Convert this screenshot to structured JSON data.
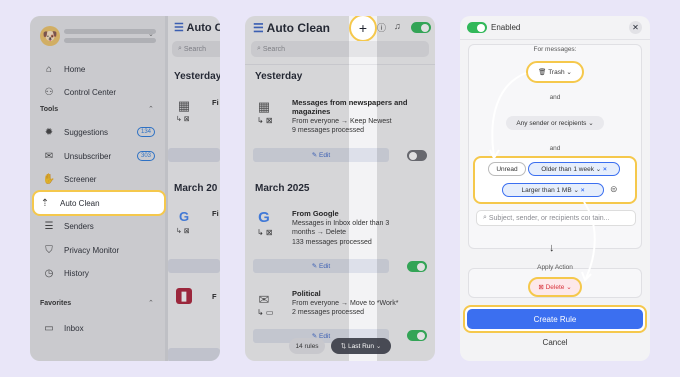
{
  "panel1": {
    "avatar": "🐶",
    "nav_items": [
      {
        "label": "Home",
        "icon": "home-icon"
      },
      {
        "label": "Control Center",
        "icon": "control-center-icon"
      }
    ],
    "tools_heading": "Tools",
    "tools": [
      {
        "label": "Suggestions",
        "icon": "lightbulb-icon",
        "badge": "134"
      },
      {
        "label": "Unsubscriber",
        "icon": "unsubscribe-icon",
        "badge": "303"
      },
      {
        "label": "Screener",
        "icon": "hand-icon",
        "badge": ""
      },
      {
        "label": "Auto Clean",
        "icon": "auto-clean-icon",
        "badge": ""
      },
      {
        "label": "Senders",
        "icon": "senders-icon",
        "badge": ""
      },
      {
        "label": "Privacy Monitor",
        "icon": "shield-icon",
        "badge": ""
      },
      {
        "label": "History",
        "icon": "history-icon",
        "badge": ""
      }
    ],
    "favorites_heading": "Favorites",
    "favorites": [
      {
        "label": "Inbox",
        "icon": "inbox-icon"
      }
    ],
    "main_title": "Auto Cl",
    "search": "Search",
    "day1": "Yesterday",
    "day2": "March 20",
    "item_snippets": [
      "Fi",
      "Fi",
      "Fi",
      "F"
    ]
  },
  "panel2": {
    "title": "Auto Clean",
    "search": "Search",
    "sections": [
      {
        "heading": "Yesterday"
      },
      {
        "heading": "March 2025"
      }
    ],
    "rules": [
      {
        "title": "Messages from newspapers and magazines",
        "line1": "From everyone → Keep Newest",
        "line2": "9 messages processed",
        "enabled": false
      },
      {
        "title": "From Google",
        "line1": "Messages in Inbox older than 3 months → Delete",
        "line2": "133 messages processed",
        "enabled": true
      },
      {
        "title": "Political",
        "line1": "From everyone → Move to *Work*",
        "line2": "2 messages processed",
        "enabled": true
      }
    ],
    "edit_label": "Edit",
    "rule_count": "14 rules",
    "sort_label": "Last Run",
    "colors": {
      "accent": "#32b85a",
      "link": "#3b66c8",
      "highlight": "#f5c84c"
    }
  },
  "panel3": {
    "enabled_label": "Enabled",
    "for_messages": "For messages:",
    "folder": "Trash",
    "and1": "and",
    "sender_select": "Any sender or recipients",
    "and2": "and",
    "unread": "Unread",
    "older": "Older than 1 week",
    "larger": "Larger than 1 MB",
    "search_placeholder": "Subject, sender, or recipients contain...",
    "apply_action": "Apply Action",
    "action": "Delete",
    "create_rule": "Create Rule",
    "cancel": "Cancel",
    "colors": {
      "primary": "#3b6ff0",
      "delete": "#d8323c",
      "highlight": "#f5c84c"
    }
  }
}
